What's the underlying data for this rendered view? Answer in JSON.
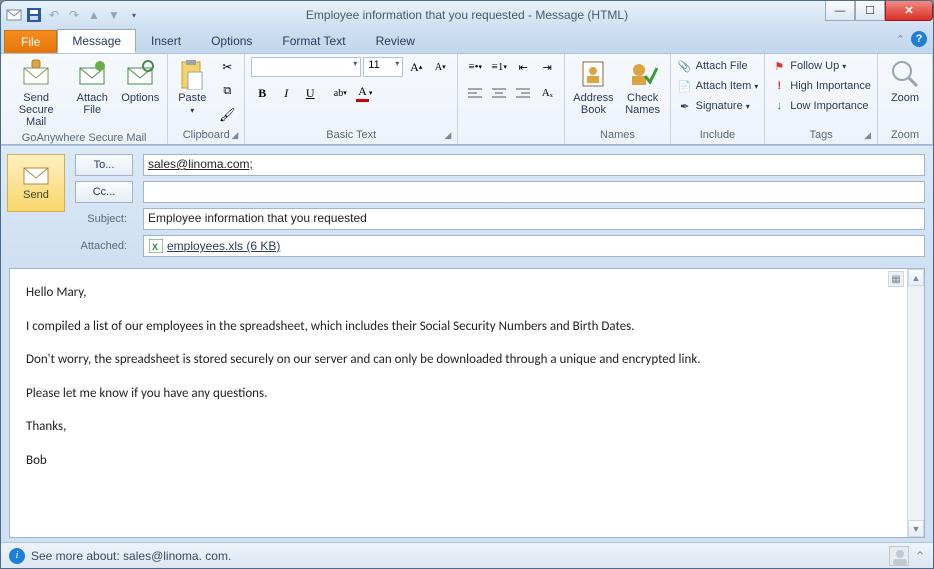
{
  "window": {
    "title": "Employee information that you requested  -  Message (HTML)"
  },
  "tabs": {
    "file": "File",
    "message": "Message",
    "insert": "Insert",
    "options": "Options",
    "format_text": "Format Text",
    "review": "Review",
    "active": "Message"
  },
  "ribbon": {
    "goanywhere": {
      "label": "GoAnywhere Secure Mail",
      "send": "Send\nSecure Mail",
      "attach": "Attach\nFile",
      "options": "Options"
    },
    "clipboard": {
      "label": "Clipboard",
      "paste": "Paste"
    },
    "basic_text": {
      "label": "Basic Text",
      "font": "",
      "size": "11"
    },
    "names": {
      "label": "Names",
      "address_book": "Address\nBook",
      "check_names": "Check\nNames"
    },
    "include": {
      "label": "Include",
      "attach_file": "Attach File",
      "attach_item": "Attach Item",
      "signature": "Signature"
    },
    "tags": {
      "label": "Tags",
      "follow_up": "Follow Up",
      "high": "High Importance",
      "low": "Low Importance"
    },
    "zoom": {
      "label": "Zoom",
      "zoom": "Zoom"
    }
  },
  "compose": {
    "send": "Send",
    "to_btn": "To...",
    "cc_btn": "Cc...",
    "subject_lbl": "Subject:",
    "attached_lbl": "Attached:",
    "to": "sales@linoma.com;",
    "cc": "",
    "subject": "Employee information that you requested",
    "attachment": "employees.xls (6 KB)"
  },
  "body": {
    "p1": "Hello Mary,",
    "p2": "I compiled a list of our employees in the spreadsheet, which includes their Social Security Numbers and Birth Dates.",
    "p3": "Don't worry, the spreadsheet is stored securely on our server and can only be downloaded through a unique and encrypted link.",
    "p4": "Please let me know if you have any questions.",
    "p5": "Thanks,",
    "p6": "Bob"
  },
  "status": {
    "text": "See more about: sales@linoma. com."
  }
}
